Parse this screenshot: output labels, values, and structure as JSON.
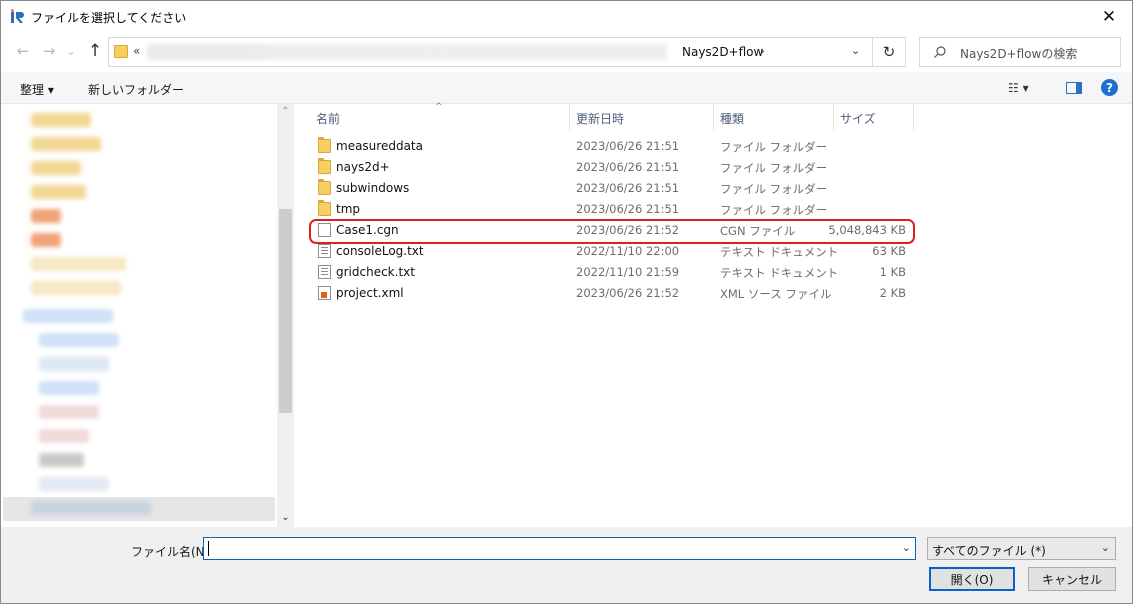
{
  "window": {
    "title": "ファイルを選択してください",
    "app_icon": "iric-logo-icon",
    "close_glyph": "✕"
  },
  "address": {
    "prefix": "«",
    "current_folder": "Nays2D+flow",
    "after_chevron": "›",
    "search_placeholder": "Nays2D+flowの検索"
  },
  "toolbar": {
    "organize_label": "整理 ▾",
    "new_folder_label": "新しいフォルダー",
    "view_label": "☷ ▾",
    "help_label": "?"
  },
  "columns": {
    "name": "名前",
    "modified": "更新日時",
    "type": "種類",
    "size": "サイズ"
  },
  "files": [
    {
      "name": "measureddata",
      "modified": "2023/06/26 21:51",
      "type": "ファイル フォルダー",
      "size": "",
      "icon": "folder-icon"
    },
    {
      "name": "nays2d+",
      "modified": "2023/06/26 21:51",
      "type": "ファイル フォルダー",
      "size": "",
      "icon": "folder-icon"
    },
    {
      "name": "subwindows",
      "modified": "2023/06/26 21:51",
      "type": "ファイル フォルダー",
      "size": "",
      "icon": "folder-icon"
    },
    {
      "name": "tmp",
      "modified": "2023/06/26 21:51",
      "type": "ファイル フォルダー",
      "size": "",
      "icon": "folder-icon"
    },
    {
      "name": "Case1.cgn",
      "modified": "2023/06/26 21:52",
      "type": "CGN ファイル",
      "size": "5,048,843 KB",
      "icon": "file-icon"
    },
    {
      "name": "consoleLog.txt",
      "modified": "2022/11/10 22:00",
      "type": "テキスト ドキュメント",
      "size": "63 KB",
      "icon": "text-file-icon"
    },
    {
      "name": "gridcheck.txt",
      "modified": "2022/11/10 21:59",
      "type": "テキスト ドキュメント",
      "size": "1 KB",
      "icon": "text-file-icon"
    },
    {
      "name": "project.xml",
      "modified": "2023/06/26 21:52",
      "type": "XML ソース ファイル",
      "size": "2 KB",
      "icon": "xml-file-icon"
    }
  ],
  "bottom": {
    "filename_label": "ファイル名(N):",
    "filename_value": "",
    "filetype_value": "すべてのファイル (*)",
    "open_label": "開く(O)",
    "cancel_label": "キャンセル"
  },
  "colors": {
    "highlight_border": "#e02020",
    "accent": "#0a62c9"
  }
}
